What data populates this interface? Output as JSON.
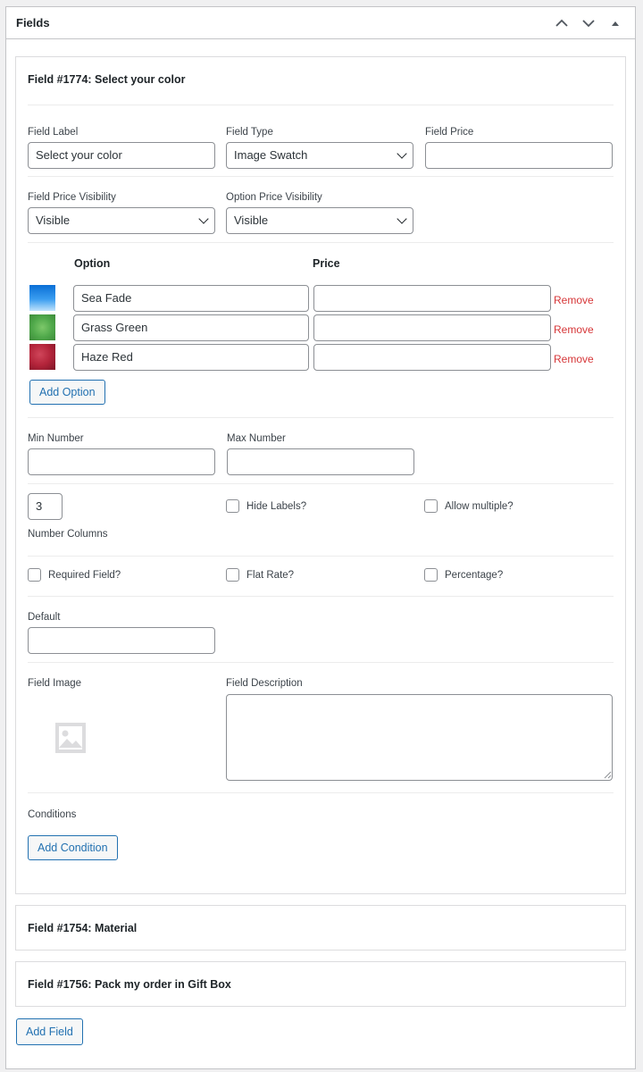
{
  "postbox": {
    "title": "Fields"
  },
  "field_open": {
    "title": "Field #1774: Select your color",
    "field_label": {
      "label": "Field Label",
      "value": "Select your color"
    },
    "field_type": {
      "label": "Field Type",
      "value": "Image Swatch"
    },
    "field_price": {
      "label": "Field Price",
      "value": ""
    },
    "field_price_visibility": {
      "label": "Field Price Visibility",
      "value": "Visible"
    },
    "option_price_visibility": {
      "label": "Option Price Visibility",
      "value": "Visible"
    },
    "options_header": {
      "option": "Option",
      "price": "Price"
    },
    "options": [
      {
        "name": "Sea Fade",
        "price": "",
        "remove": "Remove",
        "color": "#2a8fe0"
      },
      {
        "name": "Grass Green",
        "price": "",
        "remove": "Remove",
        "color": "#4fa84a"
      },
      {
        "name": "Haze Red",
        "price": "",
        "remove": "Remove",
        "color": "#b3243a"
      }
    ],
    "add_option": "Add Option",
    "min_number": {
      "label": "Min Number",
      "value": ""
    },
    "max_number": {
      "label": "Max Number",
      "value": ""
    },
    "number_columns": {
      "label": "Number Columns",
      "value": "3"
    },
    "hide_labels": "Hide Labels?",
    "allow_multiple": "Allow multiple?",
    "required_field": "Required Field?",
    "flat_rate": "Flat Rate?",
    "percentage": "Percentage?",
    "default": {
      "label": "Default",
      "value": ""
    },
    "field_image": {
      "label": "Field Image"
    },
    "field_description": {
      "label": "Field Description",
      "value": ""
    },
    "conditions": {
      "label": "Conditions",
      "button": "Add Condition"
    }
  },
  "collapsed_fields": [
    {
      "title": "Field #1754: Material"
    },
    {
      "title": "Field #1756: Pack my order in Gift Box"
    }
  ],
  "add_field": "Add Field",
  "colors": {
    "accent": "#2271b1",
    "danger": "#d63638",
    "border": "#8c8f94"
  }
}
